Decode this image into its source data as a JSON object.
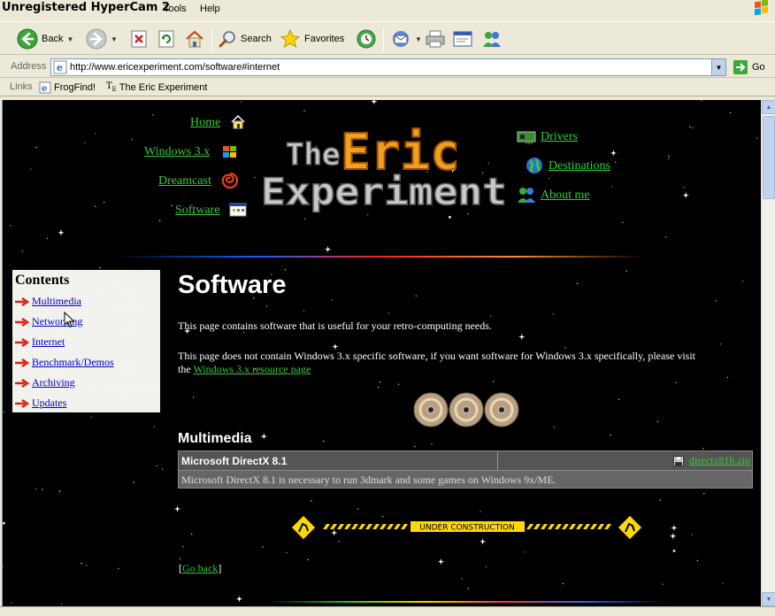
{
  "window": {
    "title": "Unregistered HyperCam 2",
    "menu": [
      "Tools",
      "Help"
    ]
  },
  "toolbar": {
    "back_label": "Back",
    "search_label": "Search",
    "favorites_label": "Favorites"
  },
  "address": {
    "label": "Address",
    "url": "http://www.ericexperiment.com/software#internet",
    "go_label": "Go"
  },
  "links": {
    "label": "Links",
    "items": [
      "FrogFind!",
      "The Eric Experiment"
    ]
  },
  "site": {
    "logo_line1_a": "The",
    "logo_line1_b": "Eric",
    "logo_line2": "Experiment",
    "nav_left": [
      "Home",
      "Windows 3.x",
      "Dreamcast",
      "Software"
    ],
    "nav_right": [
      "Drivers",
      "Destinations",
      "About me"
    ]
  },
  "contents": {
    "title": "Contents",
    "items": [
      "Multimedia",
      "Networking",
      "Internet",
      "Benchmark/Demos",
      "Archiving",
      "Updates"
    ]
  },
  "page": {
    "heading": "Software",
    "intro": "This page contains software that is useful for your retro-computing needs.",
    "note_line1": "This page does not contain Windows 3.x specific software, if you want software for Windows 3.x specifically, please visit",
    "note_prefix": "the",
    "note_link": "Windows 3.x resource page",
    "section": "Multimedia",
    "software_name": "Microsoft DirectX 8.1",
    "software_file": "directx81b.zip",
    "software_desc": "Microsoft DirectX 8.1 is necessary to run 3dmark and some games on Windows 9x/ME.",
    "construction": "UNDER CONSTRUCTION",
    "go_back": "Go back",
    "bracket_open": "[",
    "bracket_close": "]"
  },
  "colors": {
    "link_green": "#33cc33",
    "link_blue": "#0000cc",
    "logo_orange": "#f0a020",
    "logo_grey": "#c8c8c8",
    "table_header": "#555555",
    "table_row": "#666666"
  }
}
